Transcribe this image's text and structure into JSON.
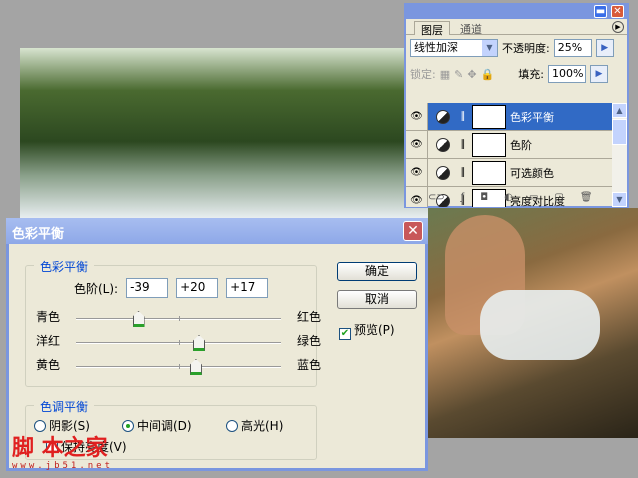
{
  "layers_panel": {
    "tabs": [
      "图层",
      "通道"
    ],
    "blend_mode": "线性加深",
    "opacity_label": "不透明度:",
    "opacity": "25%",
    "lock_label": "锁定:",
    "fill_label": "填充:",
    "fill": "100%",
    "layers": [
      {
        "name": "色彩平衡",
        "selected": true
      },
      {
        "name": "色阶"
      },
      {
        "name": "可选颜色"
      },
      {
        "name": "亮度对比度"
      }
    ]
  },
  "dialog": {
    "title": "色彩平衡",
    "group1_label": "色彩平衡",
    "levels_label": "色阶(L):",
    "levels": [
      "-39",
      "+20",
      "+17"
    ],
    "sliders": [
      {
        "left": "青色",
        "right": "红色",
        "value": -39
      },
      {
        "left": "洋红",
        "right": "绿色",
        "value": 20
      },
      {
        "left": "黄色",
        "right": "蓝色",
        "value": 17
      }
    ],
    "group2_label": "色调平衡",
    "tones": [
      "阴影(S)",
      "中间调(D)",
      "高光(H)"
    ],
    "selected_tone": 1,
    "preserve_label": "保持亮度(V)",
    "ok": "确定",
    "cancel": "取消",
    "preview_label": "预览(P)",
    "preview_checked": true
  },
  "watermark": {
    "text": "脚本之家",
    "url": "www.jb51.net"
  }
}
